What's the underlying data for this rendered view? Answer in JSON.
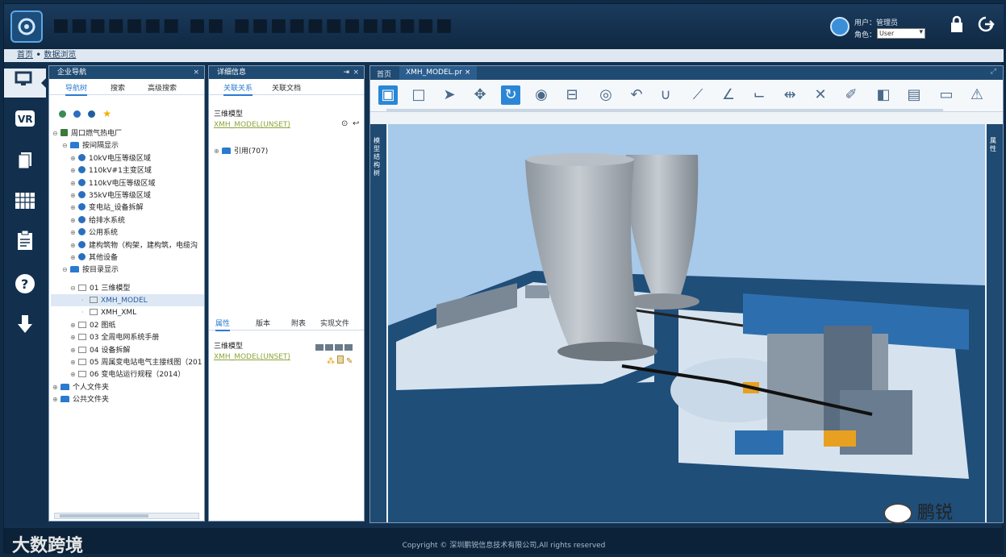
{
  "header": {
    "app_title": "■■■■■■■ ■■ ■■■■■■■■■■■■"
  },
  "user": {
    "user_label": "用户：",
    "user_name": "管理员",
    "role_label": "角色：",
    "role_value": "User"
  },
  "breadcrumb": {
    "home": "首页",
    "sep": " • ",
    "current": "数据浏览"
  },
  "nav_panel": {
    "title": "企业导航",
    "close": "×",
    "tabs": [
      "导航树",
      "搜索",
      "高级搜索"
    ],
    "tree": [
      "周口燃气热电厂",
      "按间隔显示",
      "10kV电压等级区域",
      "110kV#1主变区域",
      "110kV电压等级区域",
      "35kV电压等级区域",
      "变电站_设备拆解",
      "给排水系统",
      "公用系统",
      "建构筑物（构架，建构筑，电缆沟",
      "其他设备",
      "按目录显示",
      "01 三维模型",
      "XMH_MODEL",
      "XMH_XML",
      "02 图纸",
      "03 全周电网系统手册",
      "04 设备拆解",
      "05 周属变电站电气主接线图（201",
      "06 变电站运行规程（2014）",
      "个人文件夹",
      "公共文件夹"
    ]
  },
  "detail_panel": {
    "title": "详细信息",
    "close": "×",
    "tabs_top": [
      "关联关系",
      "关联文档"
    ],
    "section1_label": "三维模型",
    "section1_link": "XMH_MODEL(UNSET)",
    "related_node": "引用(707)",
    "tabs_bottom": [
      "属性",
      "版本",
      "附表",
      "实现文件"
    ],
    "section2_label": "三维模型",
    "section2_link": "XMH_MODEL(UNSET)"
  },
  "viewer": {
    "tab_home": "首页",
    "tab_model": "XMH_MODEL.pr ×",
    "left_handle": "模型结构树",
    "right_handle": "属性"
  },
  "footer": {
    "copyright": "Copyright © 深圳鹏锐信息技术有限公司,All rights reserved"
  },
  "watermarks": {
    "left": "大数跨境",
    "right": "鹏锐"
  }
}
